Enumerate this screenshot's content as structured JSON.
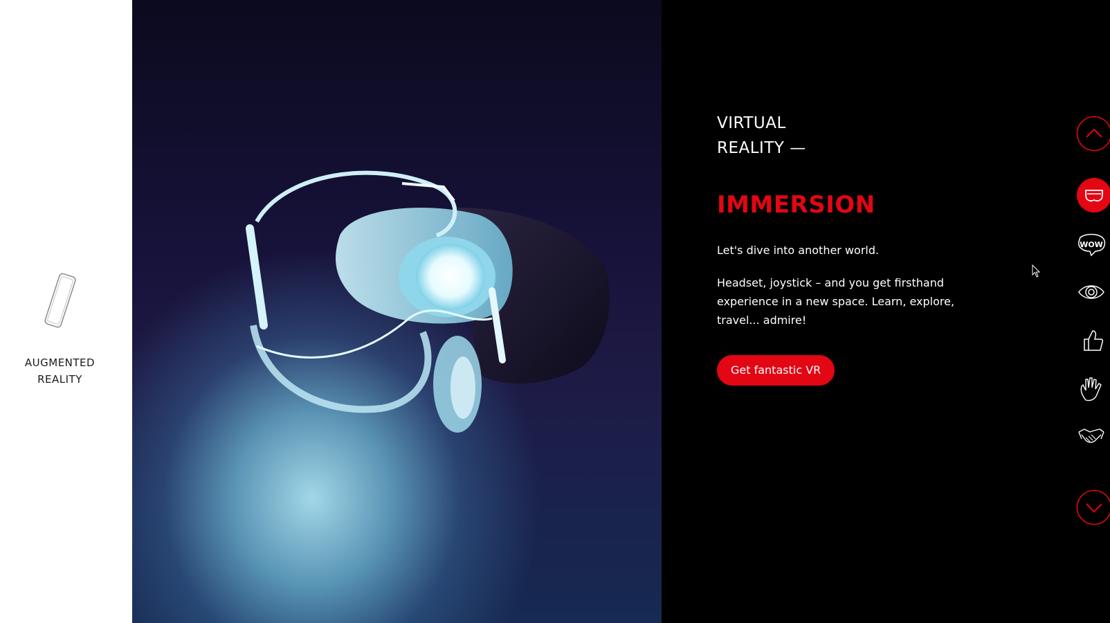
{
  "left_panel": {
    "ar_label_line1": "AUGMENTED",
    "ar_label_line2": "REALITY",
    "icon": "smartphone-icon"
  },
  "hero_image": {
    "subject": "vr-headset",
    "accent": "#9fe0f0"
  },
  "content": {
    "kicker_line1": "VIRTUAL",
    "kicker_line2": "REALITY —",
    "headline": "IMMERSION",
    "paragraph1": "Let's dive into another world.",
    "paragraph2": "Headset, joystick – and you get firsthand experience in a new space. Learn, explore, travel... admire!",
    "cta_label": "Get fantastic VR"
  },
  "nav_rail": {
    "up_icon": "chevron-up-icon",
    "down_icon": "chevron-down-icon",
    "items": [
      {
        "icon": "vr-headset-icon",
        "active": true
      },
      {
        "icon": "wow-icon",
        "active": false
      },
      {
        "icon": "eye-icon",
        "active": false
      },
      {
        "icon": "thumbs-up-icon",
        "active": false
      },
      {
        "icon": "hand-icon",
        "active": false
      },
      {
        "icon": "handshake-icon",
        "active": false
      }
    ]
  },
  "colors": {
    "accent_red": "#e30613",
    "background_dark": "#000000",
    "left_panel_bg": "#ffffff",
    "text_light": "#ffffff"
  }
}
